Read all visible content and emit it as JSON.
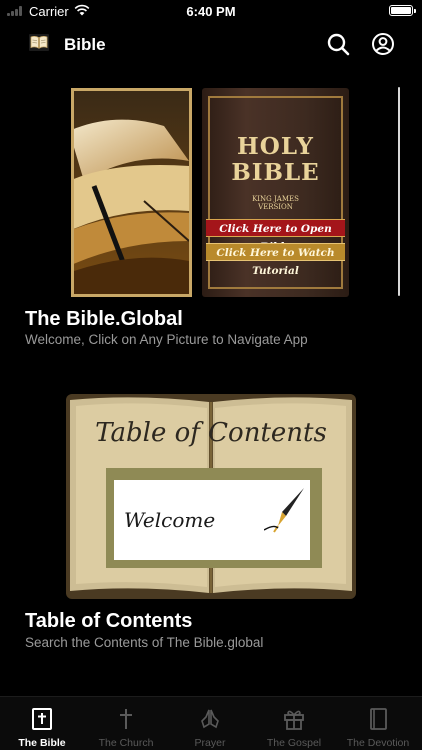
{
  "status_bar": {
    "carrier": "Carrier",
    "time": "6:40 PM",
    "battery_level": 1.0
  },
  "navbar": {
    "title": "Bible",
    "logo_icon": "book-icon",
    "search_icon": "search-icon",
    "profile_icon": "user-circle-icon"
  },
  "cards": [
    {
      "title": "The Bible.Global",
      "subtitle": "Welcome, Click on Any Picture to Navigate App",
      "cover_title_line1": "HOLY",
      "cover_title_line2": "BIBLE",
      "cover_version_line1": "KING JAMES",
      "cover_version_line2": "VERSION",
      "open_bible_label": "Click Here to Open Bible",
      "tutorial_label": "Click Here to Watch Tutorial"
    },
    {
      "title": "Table of Contents",
      "subtitle": "Search the Contents of The Bible.global",
      "book_heading": "Table of Contents",
      "welcome_text": "Welcome"
    }
  ],
  "tabs": [
    {
      "label": "The Bible",
      "icon": "bible-cross-icon",
      "active": true
    },
    {
      "label": "The Church",
      "icon": "cross-icon",
      "active": false
    },
    {
      "label": "Prayer",
      "icon": "prayer-hands-icon",
      "active": false
    },
    {
      "label": "The Gospel",
      "icon": "gift-icon",
      "active": false
    },
    {
      "label": "The Devotion",
      "icon": "book-icon",
      "active": false
    }
  ],
  "colors": {
    "background": "#000000",
    "tab_active": "#ffffff",
    "tab_inactive": "#5a5a5a",
    "subtitle": "#9a9a9a",
    "open_bible_button": "#a4151a",
    "tutorial_button": "#b98a2b"
  }
}
